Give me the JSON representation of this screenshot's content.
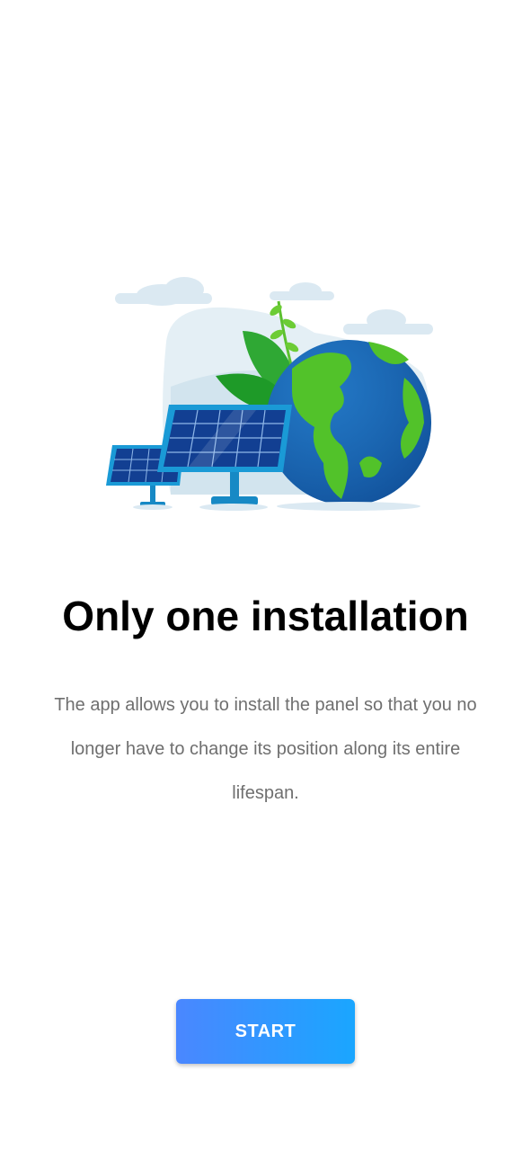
{
  "onboarding": {
    "illustration_icon": "solar-panel-earth-illustration",
    "title": "Only one installation",
    "description": "The app allows you to install the panel so that you no longer have to change its position along its entire lifespan.",
    "start_label": "START"
  },
  "colors": {
    "button_gradient_start": "#4a87ff",
    "button_gradient_end": "#1aa6ff",
    "title": "#000000",
    "description": "#6f6f6f"
  }
}
